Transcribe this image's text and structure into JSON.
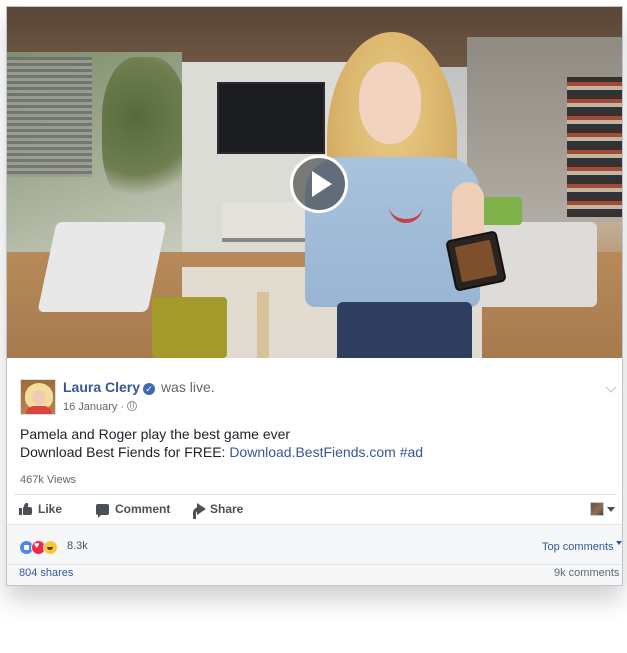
{
  "post": {
    "poster_name": "Laura Clery",
    "action_text": "was live.",
    "date": "16 January",
    "meta_separator": "·",
    "text_line1": "Pamela and Roger play the best game ever",
    "text_line2_prefix": "Download Best Fiends for FREE: ",
    "link_text": "Download.BestFiends.com",
    "hashtag": "#ad",
    "views": "467k Views"
  },
  "actions": {
    "like_label": "Like",
    "comment_label": "Comment",
    "share_label": "Share"
  },
  "reactions": {
    "count": "8.3k",
    "types": [
      "like",
      "love",
      "haha"
    ],
    "top_comments_label": "Top comments"
  },
  "footer": {
    "shares": "804 shares",
    "comments": "9k comments"
  },
  "colors": {
    "link_blue": "#365899",
    "text": "#1d2129",
    "muted": "#616770",
    "like_blue": "#4b88f0",
    "love_red": "#f0284a",
    "haha_yellow": "#f7c73a"
  },
  "icons": [
    "play-icon",
    "verified-icon",
    "globe-icon",
    "chevron-down-icon",
    "like-icon",
    "comment-icon",
    "share-icon",
    "caret-icon"
  ]
}
